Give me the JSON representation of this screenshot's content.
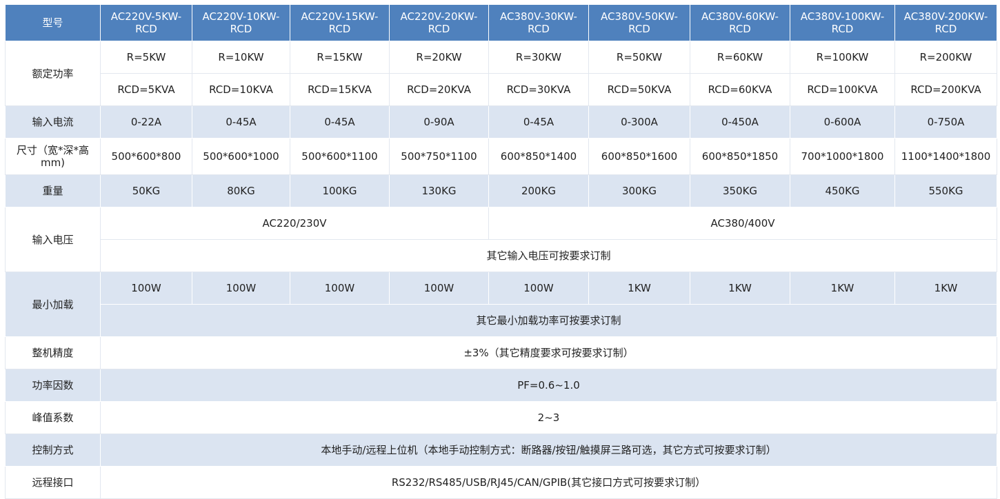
{
  "header": {
    "label": "型号",
    "models": [
      "AC220V-5KW-RCD",
      "AC220V-10KW-RCD",
      "AC220V-15KW-RCD",
      "AC220V-20KW-RCD",
      "AC380V-30KW-RCD",
      "AC380V-50KW-RCD",
      "AC380V-60KW-RCD",
      "AC380V-100KW-RCD",
      "AC380V-200KW-RCD"
    ]
  },
  "rated_power": {
    "label": "额定功率",
    "r_values": [
      "R=5KW",
      "R=10KW",
      "R=15KW",
      "R=20KW",
      "R=30KW",
      "R=50KW",
      "R=60KW",
      "R=100KW",
      "R=200KW"
    ],
    "rcd_values": [
      "RCD=5KVA",
      "RCD=10KVA",
      "RCD=15KVA",
      "RCD=20KVA",
      "RCD=30KVA",
      "RCD=50KVA",
      "RCD=60KVA",
      "RCD=100KVA",
      "RCD=200KVA"
    ]
  },
  "input_current": {
    "label": "输入电流",
    "values": [
      "0-22A",
      "0-45A",
      "0-45A",
      "0-90A",
      "0-45A",
      "0-300A",
      "0-450A",
      "0-600A",
      "0-750A"
    ]
  },
  "dimensions": {
    "label": "尺寸（宽*深*高mm)",
    "values": [
      "500*600*800",
      "500*600*1000",
      "500*600*1100",
      "500*750*1100",
      "600*850*1400",
      "600*850*1600",
      "600*850*1850",
      "700*1000*1800",
      "1100*1400*1800"
    ]
  },
  "weight": {
    "label": "重量",
    "values": [
      "50KG",
      "80KG",
      "100KG",
      "130KG",
      "200KG",
      "300KG",
      "350KG",
      "450KG",
      "550KG"
    ]
  },
  "input_voltage": {
    "label": "输入电压",
    "ac220": "AC220/230V",
    "ac380": "AC380/400V",
    "note": "其它输入电压可按要求订制"
  },
  "min_load": {
    "label": "最小加载",
    "values": [
      "100W",
      "100W",
      "100W",
      "100W",
      "100W",
      "1KW",
      "1KW",
      "1KW",
      "1KW"
    ],
    "note": "其它最小加载功率可按要求订制"
  },
  "accuracy": {
    "label": "整机精度",
    "value": "±3%（其它精度要求可按要求订制）"
  },
  "power_factor": {
    "label": "功率因数",
    "value": "PF=0.6~1.0"
  },
  "crest_factor": {
    "label": "峰值系数",
    "value": "2~3"
  },
  "control_mode": {
    "label": "控制方式",
    "value": "本地手动/远程上位机（本地手动控制方式：断路器/按钮/触摸屏三路可选，其它方式可按要求订制）"
  },
  "remote_interface": {
    "label": "远程接口",
    "value": "RS232/RS485/USB/RJ45/CAN/GPIB(其它接口方式可按要求订制）"
  },
  "colors": {
    "header_bg": "#4f81bd",
    "header_text": "#ffffff",
    "band_bg": "#dbe4f1",
    "plain_bg": "#ffffff",
    "text": "#222222"
  }
}
